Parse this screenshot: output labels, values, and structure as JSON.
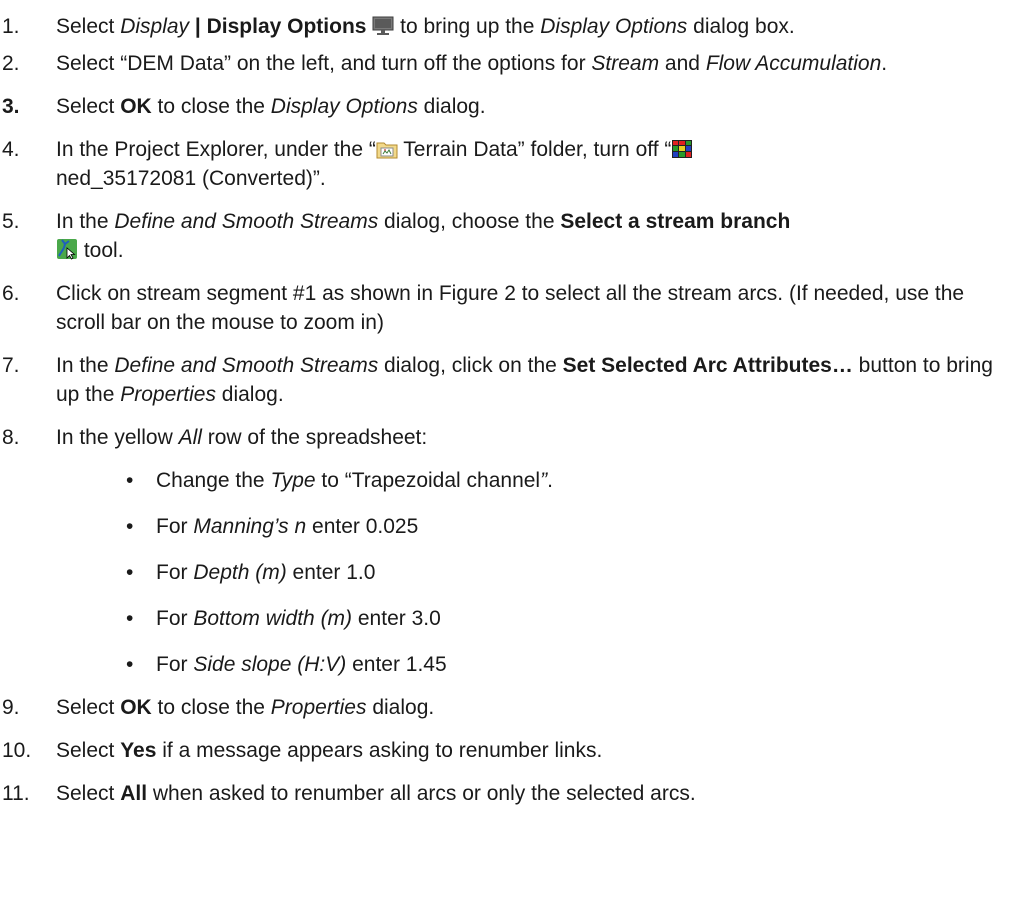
{
  "steps": [
    {
      "number": "1.",
      "parts": {
        "a": "Select ",
        "b": "Display",
        "c": " | Display Options",
        "d": " to bring up the ",
        "e": "Display Options",
        "f": " dialog box."
      }
    },
    {
      "number": "2.",
      "parts": {
        "a": "Select “DEM Data” on the left, and turn off the options for ",
        "b": "Stream",
        "c": " and ",
        "d": "Flow Accumulation",
        "e": "."
      }
    },
    {
      "number": "3.",
      "parts": {
        "a": "Select ",
        "b": "OK",
        "c": " to close the ",
        "d": "Display Options",
        "e": " dialog."
      }
    },
    {
      "number": "4.",
      "parts": {
        "a": "In the Project Explorer, under the “",
        "b": " Terrain Data” folder, turn off “",
        "c": " ned_35172081 (Converted)”."
      }
    },
    {
      "number": "5.",
      "parts": {
        "a": "In the ",
        "b": "Define and Smooth Streams",
        "c": " dialog, choose the ",
        "d": "Select a stream branch",
        "e": " tool."
      }
    },
    {
      "number": "6.",
      "parts": {
        "a": "Click on stream segment #1 as shown in Figure 2 to select all the stream arcs. (If needed, use the scroll bar on the mouse to zoom in)"
      }
    },
    {
      "number": "7.",
      "parts": {
        "a": "In the ",
        "b": "Define and Smooth Streams",
        "c": " dialog, click on the ",
        "d": "Set Selected Arc Attributes…",
        "e": " button to bring up the ",
        "f": "Properties",
        "g": " dialog."
      }
    },
    {
      "number": "8.",
      "parts": {
        "a": "In the yellow ",
        "b": "All",
        "c": " row of the spreadsheet:"
      },
      "bullets": [
        {
          "dot": "•",
          "a": "Change the ",
          "b": "Type",
          "c": " to “Trapezoidal channel",
          "d": "”",
          "e": "."
        },
        {
          "dot": "•",
          "a": "For ",
          "b": "Manning’s n",
          "c": " enter 0.025"
        },
        {
          "dot": "•",
          "a": "For ",
          "b": "Depth (m)",
          "c": " enter 1.0"
        },
        {
          "dot": "•",
          "a": "For ",
          "b": "Bottom width (m)",
          "c": " enter 3.0"
        },
        {
          "dot": "•",
          "a": "For ",
          "b": "Side slope (H:V)",
          "c": " enter 1.45"
        }
      ]
    },
    {
      "number": "9.",
      "parts": {
        "a": "Select ",
        "b": "OK",
        "c": " to close the ",
        "d": "Properties",
        "e": " dialog."
      }
    },
    {
      "number": "10.",
      "parts": {
        "a": "Select ",
        "b": "Yes",
        "c": " if a message appears asking to renumber links."
      }
    },
    {
      "number": "11.",
      "parts": {
        "a": "Select ",
        "b": "All",
        "c": " when asked to renumber all arcs or only the selected arcs."
      }
    }
  ],
  "icons": {
    "display_options": "monitor-icon",
    "terrain_folder": "terrain-folder-icon",
    "dem_grid": "grid-icon",
    "stream_branch_tool": "select-stream-branch-icon"
  }
}
